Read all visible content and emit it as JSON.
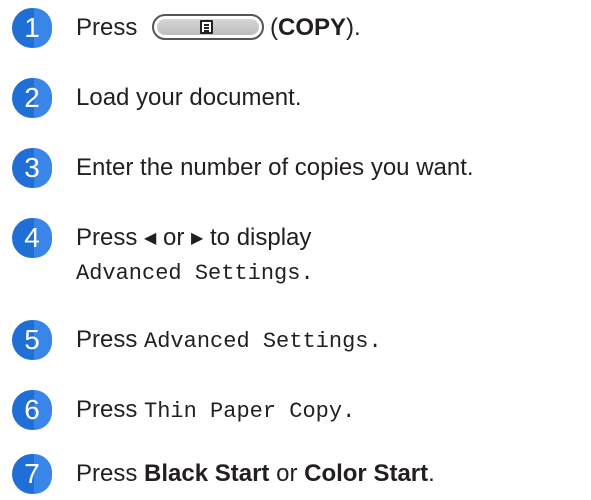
{
  "steps": [
    {
      "number": "1",
      "parts": {
        "a": "Press",
        "b": "(",
        "c": "COPY",
        "d": ")."
      },
      "icon": "copy-icon"
    },
    {
      "number": "2",
      "text": "Load your document."
    },
    {
      "number": "3",
      "text": "Enter the number of copies you want."
    },
    {
      "number": "4",
      "parts": {
        "a": "Press",
        "left_arrow": "◀",
        "b": "or",
        "right_arrow": "▶",
        "c": "to display",
        "mono": "Advanced Settings",
        "d": "."
      }
    },
    {
      "number": "5",
      "parts": {
        "a": "Press",
        "mono": "Advanced Settings",
        "b": "."
      }
    },
    {
      "number": "6",
      "parts": {
        "a": "Press",
        "mono": "Thin Paper Copy",
        "b": "."
      }
    },
    {
      "number": "7",
      "parts": {
        "a": "Press",
        "bold1": "Black Start",
        "b": "or",
        "bold2": "Color Start",
        "c": "."
      }
    }
  ],
  "colors": {
    "step_badge": "#1f6fd6",
    "text": "#231f20"
  }
}
